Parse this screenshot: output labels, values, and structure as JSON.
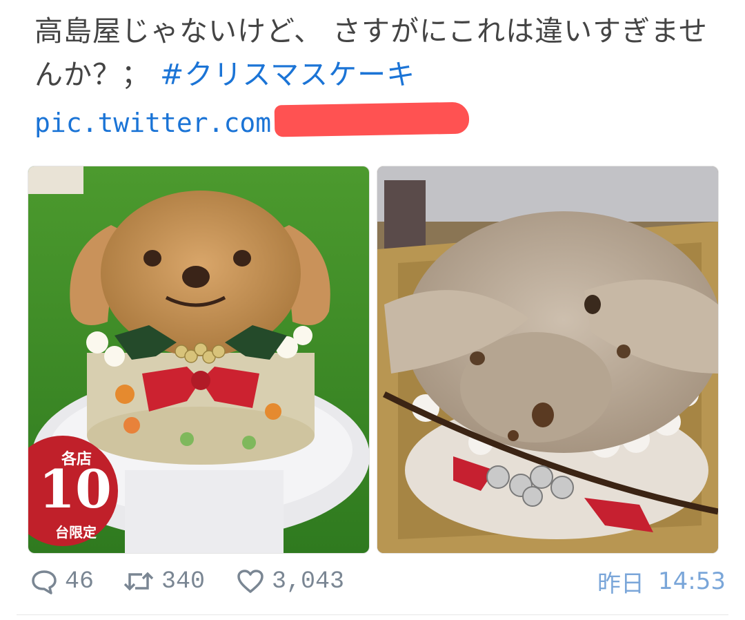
{
  "tweet": {
    "text": "高島屋じゃないけど、 さすがにこれは違いすぎませんか？；",
    "hashtag": "#クリスマスケーキ",
    "link_prefix": "pic.twitter.com"
  },
  "media": {
    "left_badge": {
      "line1": "各店",
      "number": "10",
      "line3": "台限定"
    }
  },
  "actions": {
    "reply_count": "46",
    "retweet_count": "340",
    "like_count": "3,043"
  },
  "timestamp": {
    "day": "昨日",
    "time": "14:53"
  },
  "colors": {
    "link": "#1b74d6",
    "muted": "#7a8693",
    "redaction": "#ff5252",
    "badge": "#c0202a"
  }
}
